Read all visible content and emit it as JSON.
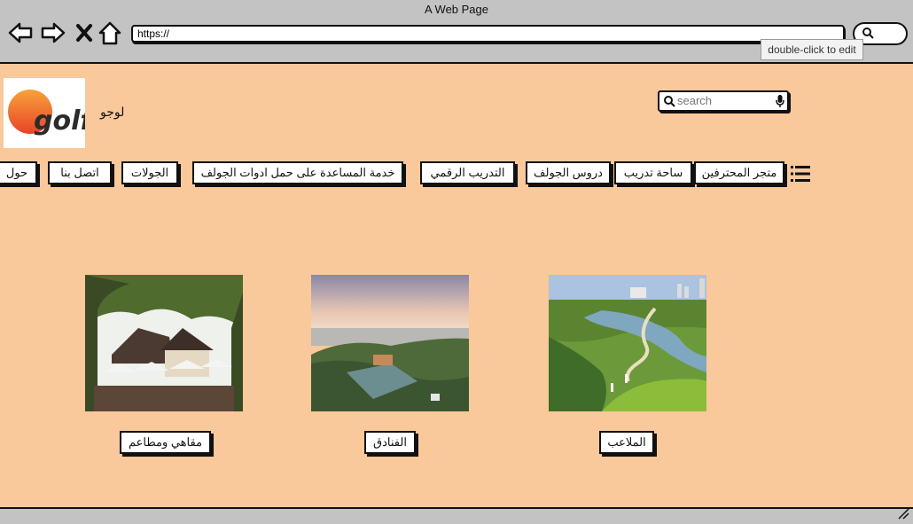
{
  "browser": {
    "title": "A Web Page",
    "url": "https://",
    "tooltip": "double-click to edit"
  },
  "header": {
    "logo_text": "golf",
    "logo_label": "لوجو",
    "search_placeholder": "search"
  },
  "nav": {
    "items": [
      "متجر المحترفين",
      "ساحة تدريب",
      "دروس الجولف",
      "التدريب الرقمي",
      "خدمة المساعدة على حمل ادوات الجولف",
      "الجولات",
      "اتصل بنا",
      "حول"
    ]
  },
  "cards": [
    {
      "caption": "الملاعب",
      "image": "golf-course-photo"
    },
    {
      "caption": "الفنادق",
      "image": "hotel-resort-photo"
    },
    {
      "caption": "مقاهي ومطاعم",
      "image": "cafe-restaurant-photo"
    }
  ],
  "colors": {
    "page_background": "#f9c89b",
    "browser_chrome": "#c3c3c3",
    "logo_orange": "#f06a20"
  }
}
